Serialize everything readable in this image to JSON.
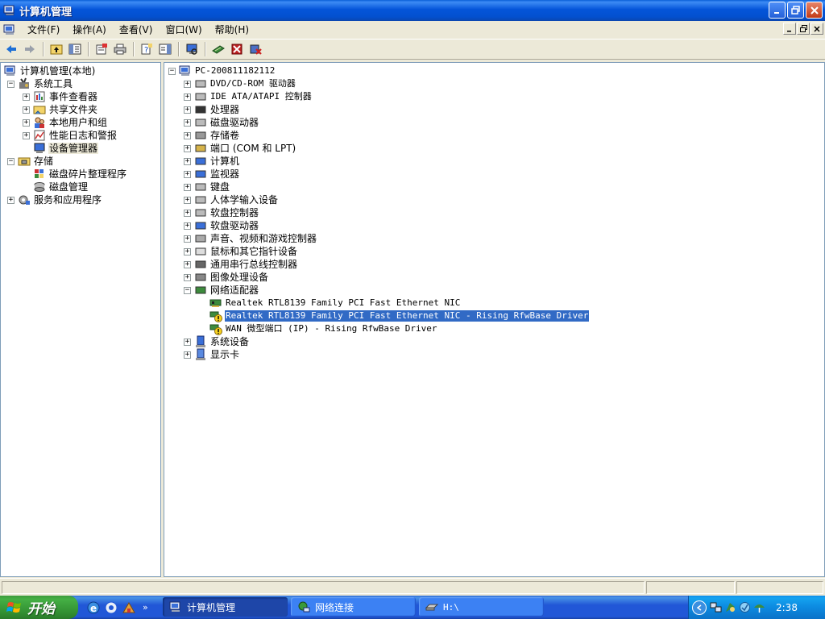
{
  "window": {
    "title": "计算机管理"
  },
  "menu": {
    "items": [
      "文件(F)",
      "操作(A)",
      "查看(V)",
      "窗口(W)",
      "帮助(H)"
    ]
  },
  "toolbar": {
    "icons": [
      "back-arrow",
      "forward-arrow",
      "up-folder",
      "show-hide-tree",
      "properties",
      "print",
      "help",
      "show-hide-action-pane",
      "scan-hardware",
      "update-driver",
      "disable-device",
      "uninstall-device"
    ]
  },
  "left_tree": {
    "root": "计算机管理(本地)",
    "items": [
      {
        "label": "系统工具",
        "level": 1,
        "expander": "−"
      },
      {
        "label": "事件查看器",
        "level": 2,
        "expander": "+"
      },
      {
        "label": "共享文件夹",
        "level": 2,
        "expander": "+"
      },
      {
        "label": "本地用户和组",
        "level": 2,
        "expander": "+"
      },
      {
        "label": "性能日志和警报",
        "level": 2,
        "expander": "+"
      },
      {
        "label": "设备管理器",
        "level": 2,
        "expander": ""
      },
      {
        "label": "存储",
        "level": 1,
        "expander": "−"
      },
      {
        "label": "磁盘碎片整理程序",
        "level": 2,
        "expander": ""
      },
      {
        "label": "磁盘管理",
        "level": 2,
        "expander": ""
      },
      {
        "label": "服务和应用程序",
        "level": 1,
        "expander": "+"
      }
    ]
  },
  "device_tree": {
    "root": "PC-200811182112",
    "categories": [
      "DVD/CD-ROM 驱动器",
      "IDE ATA/ATAPI 控制器",
      "处理器",
      "磁盘驱动器",
      "存储卷",
      "端口 (COM 和 LPT)",
      "计算机",
      "监视器",
      "键盘",
      "人体学输入设备",
      "软盘控制器",
      "软盘驱动器",
      "声音、视频和游戏控制器",
      "鼠标和其它指针设备",
      "通用串行总线控制器",
      "图像处理设备",
      "网络适配器"
    ],
    "network_adapters": [
      {
        "label": "Realtek RTL8139 Family PCI Fast Ethernet NIC",
        "warning": false
      },
      {
        "label": "Realtek RTL8139 Family PCI Fast Ethernet NIC - Rising RfwBase Driver",
        "warning": true,
        "selected": true
      },
      {
        "label": "WAN 微型端口 (IP) - Rising RfwBase Driver",
        "warning": true
      }
    ],
    "after": [
      "系统设备",
      "显示卡"
    ]
  },
  "taskbar": {
    "start_label": "开始",
    "tasks": [
      {
        "label": "计算机管理",
        "active": true
      },
      {
        "label": "网络连接",
        "active": false
      },
      {
        "label": "H:\\",
        "active": false
      }
    ],
    "clock": "2:38"
  },
  "colors": {
    "title_bar": "#0455d9",
    "selection": "#316ac5",
    "taskbar": "#2157d7",
    "start_button": "#3c9a3c"
  }
}
